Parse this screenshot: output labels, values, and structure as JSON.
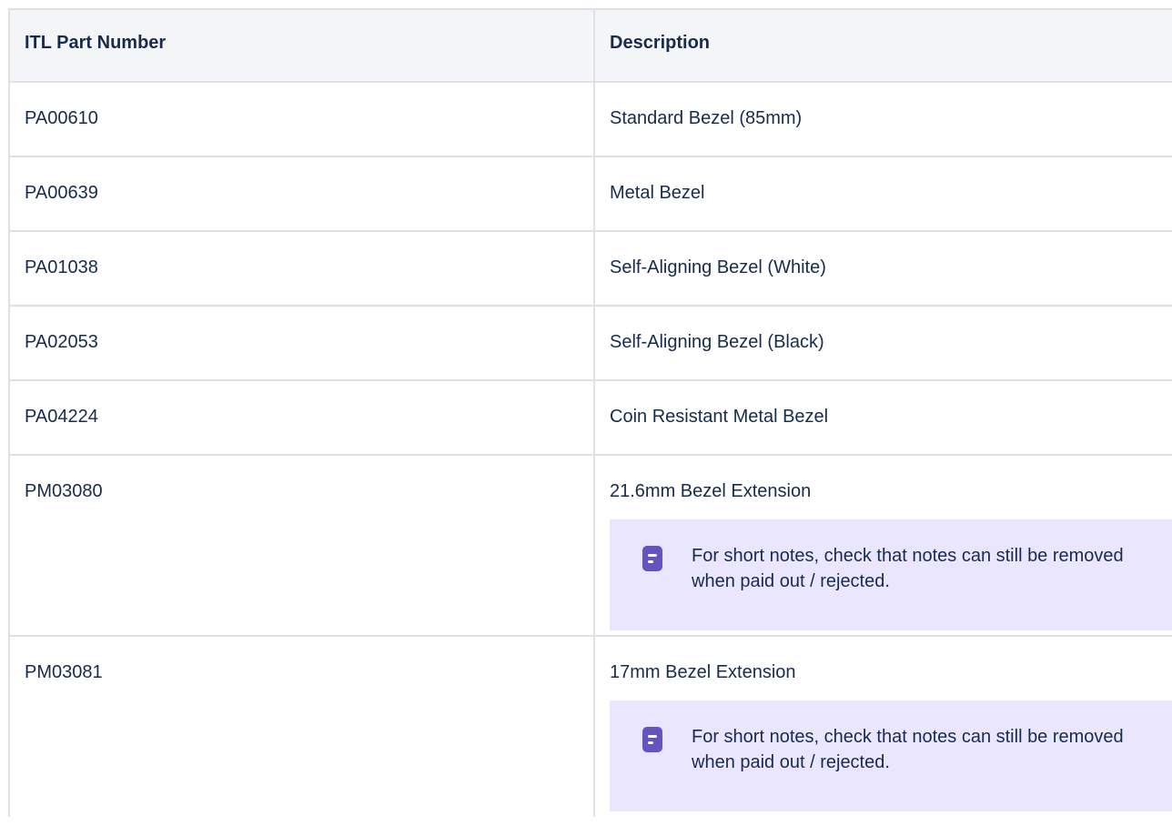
{
  "table": {
    "headers": {
      "part_number": "ITL Part Number",
      "description": "Description"
    },
    "rows": [
      {
        "part": "PA00610",
        "description": "Standard Bezel (85mm)"
      },
      {
        "part": "PA00639",
        "description": "Metal Bezel"
      },
      {
        "part": "PA01038",
        "description": "Self-Aligning Bezel (White)"
      },
      {
        "part": "PA02053",
        "description": "Self-Aligning Bezel (Black)"
      },
      {
        "part": "PA04224",
        "description": "Coin Resistant Metal Bezel"
      },
      {
        "part": "PM03080",
        "description": "21.6mm Bezel Extension",
        "note": "For short notes, check that notes can still be removed when paid out / rejected."
      },
      {
        "part": "PM03081",
        "description": "17mm Bezel Extension",
        "note": "For short notes, check that notes can still be removed when paid out / rejected."
      }
    ]
  },
  "icons": {
    "note": "note-icon"
  },
  "colors": {
    "note_background": "#eae6ff",
    "note_icon": "#6554c0",
    "header_background": "#f4f5f7",
    "border": "#dfe1e6",
    "text": "#172b4d"
  }
}
